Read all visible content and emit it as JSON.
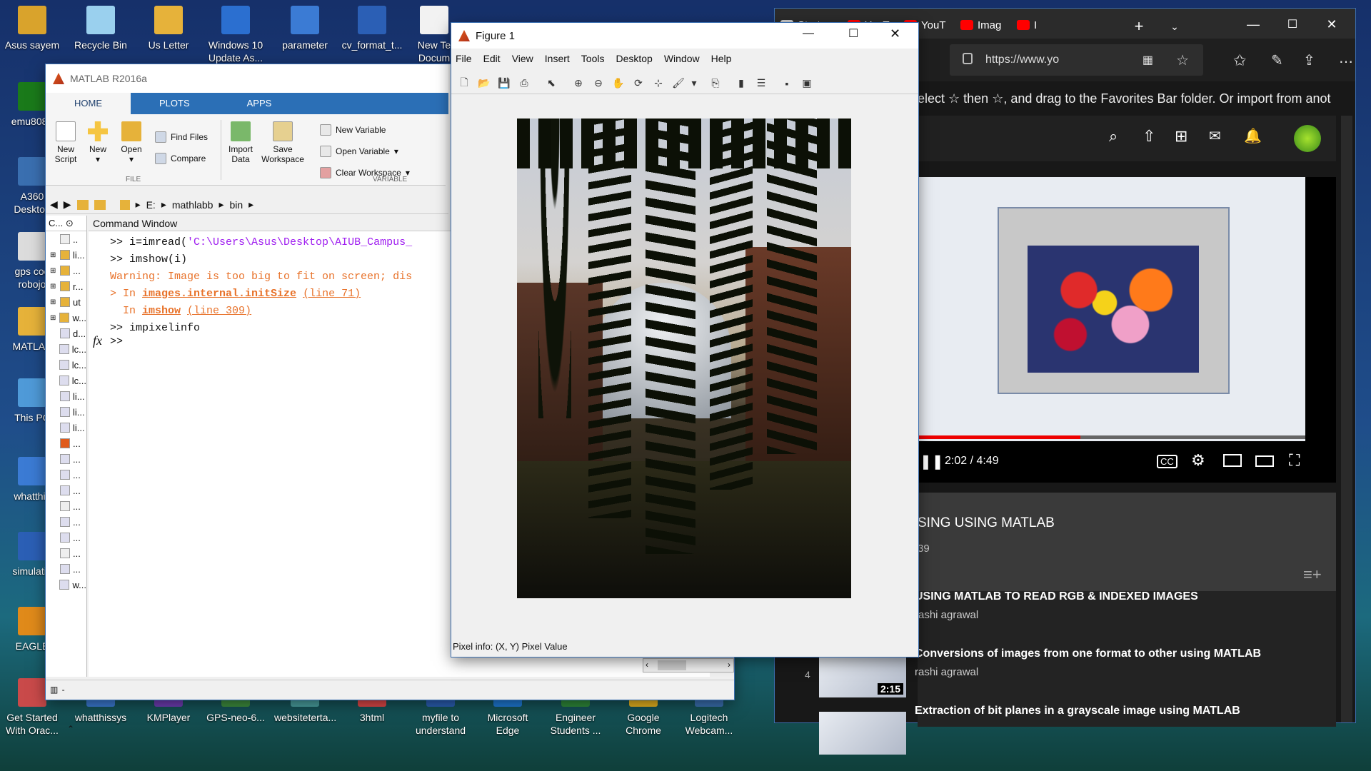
{
  "desktop": {
    "icons_left": [
      {
        "label": "Asus sayem",
        "color": "#d9a32c"
      },
      {
        "label": "emu8086",
        "color": "#1a7a1a"
      },
      {
        "label": "A360 Desktop",
        "color": "#3a6fb0"
      },
      {
        "label": "gps cod robojo",
        "color": "#dcdcdc"
      },
      {
        "label": "MATLAB",
        "color": "#e6b23a"
      },
      {
        "label": "This PC",
        "color": "#4f9ad8"
      },
      {
        "label": "whatthis",
        "color": "#3b7bd4"
      },
      {
        "label": "simulatio",
        "color": "#2b5fb5"
      },
      {
        "label": "EAGLE",
        "color": "#e08a1a"
      },
      {
        "label": "Get Started With Orac...",
        "color": "#c94a4a"
      }
    ],
    "icons_top": [
      {
        "label": "Recycle Bin",
        "color": "#9ad0ee"
      },
      {
        "label": "Us Letter",
        "color": "#e6b23a"
      },
      {
        "label": "Windows 10 Update As...",
        "color": "#2b6fd0"
      },
      {
        "label": "parameter",
        "color": "#3b7bd4"
      },
      {
        "label": "cv_format_t...",
        "color": "#2b5fb5"
      },
      {
        "label": "New Te Docum",
        "color": "#f2f2f2"
      }
    ],
    "icons_bottom": [
      {
        "label": "whatthissys",
        "color": "#3b7bd4"
      },
      {
        "label": "KMPlayer",
        "color": "#6f3db5"
      },
      {
        "label": "GPS-neo-6...",
        "color": "#3e8e3e"
      },
      {
        "label": "websiteterta...",
        "color": "#4aa0a0"
      },
      {
        "label": "3html",
        "color": "#e04848"
      },
      {
        "label": "myfile to understand",
        "color": "#2b5fb5"
      },
      {
        "label": "Microsoft Edge",
        "color": "#1e7ad6"
      },
      {
        "label": "Engineer Students ...",
        "color": "#2f8a3a"
      },
      {
        "label": "Google Chrome",
        "color": "#e8b31f"
      },
      {
        "label": "Logitech Webcam...",
        "color": "#3a6fb0"
      }
    ]
  },
  "matlab": {
    "title": "MATLAB R2016a",
    "tabs": [
      "HOME",
      "PLOTS",
      "APPS"
    ],
    "ribbon": {
      "new_script": "New Script",
      "new": "New",
      "open": "Open",
      "find_files": "Find Files",
      "compare": "Compare",
      "import_data": "Import Data",
      "save_workspace": "Save Workspace",
      "new_variable": "New Variable",
      "open_variable": "Open Variable",
      "clear_workspace": "Clear Workspace",
      "group_file": "FILE",
      "group_variable": "VARIABLE"
    },
    "path": [
      "E:",
      "mathlabb",
      "bin"
    ],
    "current_folder_label": "C...",
    "command_window_title": "Command Window",
    "file_list": [
      "..",
      "li...",
      "...",
      "r...",
      "ut",
      "w...",
      "d...",
      "lc...",
      "lc...",
      "lc...",
      "li...",
      "li...",
      "li...",
      "...",
      "...",
      "...",
      "...",
      "...",
      "...",
      "...",
      "...",
      "...",
      "w..."
    ],
    "commands": [
      {
        "prompt": ">> ",
        "text": "i=imread(",
        "str": "'C:\\Users\\Asus\\Desktop\\AIUB_Campus_"
      },
      {
        "prompt": ">> ",
        "text": "imshow(i)"
      },
      {
        "warning": "Warning: Image is too big to fit on screen; dis"
      },
      {
        "prefix": "> In ",
        "link": "images.internal.initSize",
        "line": "(line 71)"
      },
      {
        "prefix": "  In ",
        "link": "imshow",
        "line": "(line 309)"
      },
      {
        "prompt": ">> ",
        "text": "impixelinfo"
      }
    ],
    "fx_prompt": ">>"
  },
  "figure": {
    "title": "Figure 1",
    "menu": [
      "File",
      "Edit",
      "View",
      "Insert",
      "Tools",
      "Desktop",
      "Window",
      "Help"
    ],
    "pixel_info": "Pixel info: (X, Y)  Pixel Value"
  },
  "browser": {
    "tabs": [
      "Start",
      "YouT",
      "YouT",
      "Imag",
      "I"
    ],
    "url": "https://www.yo",
    "favorites_hint": "elect  ☆  then ☆, and drag to the Favorites Bar folder. Or import from anot",
    "video_time": "2:02 / 4:49",
    "progress": 0.42,
    "video_title": "SING USING MATLAB",
    "views": "39",
    "playlist": [
      {
        "title": "USING MATLAB TO READ RGB & INDEXED IMAGES",
        "author": "rashi agrawal",
        "index": "",
        "duration": ""
      },
      {
        "title": "Conversions of images from one format to other using MATLAB",
        "author": "rashi agrawal",
        "index": "4",
        "duration": "2:15"
      },
      {
        "title": "Extraction of bit planes in a grayscale image using MATLAB",
        "author": "",
        "index": "",
        "duration": ""
      }
    ]
  }
}
